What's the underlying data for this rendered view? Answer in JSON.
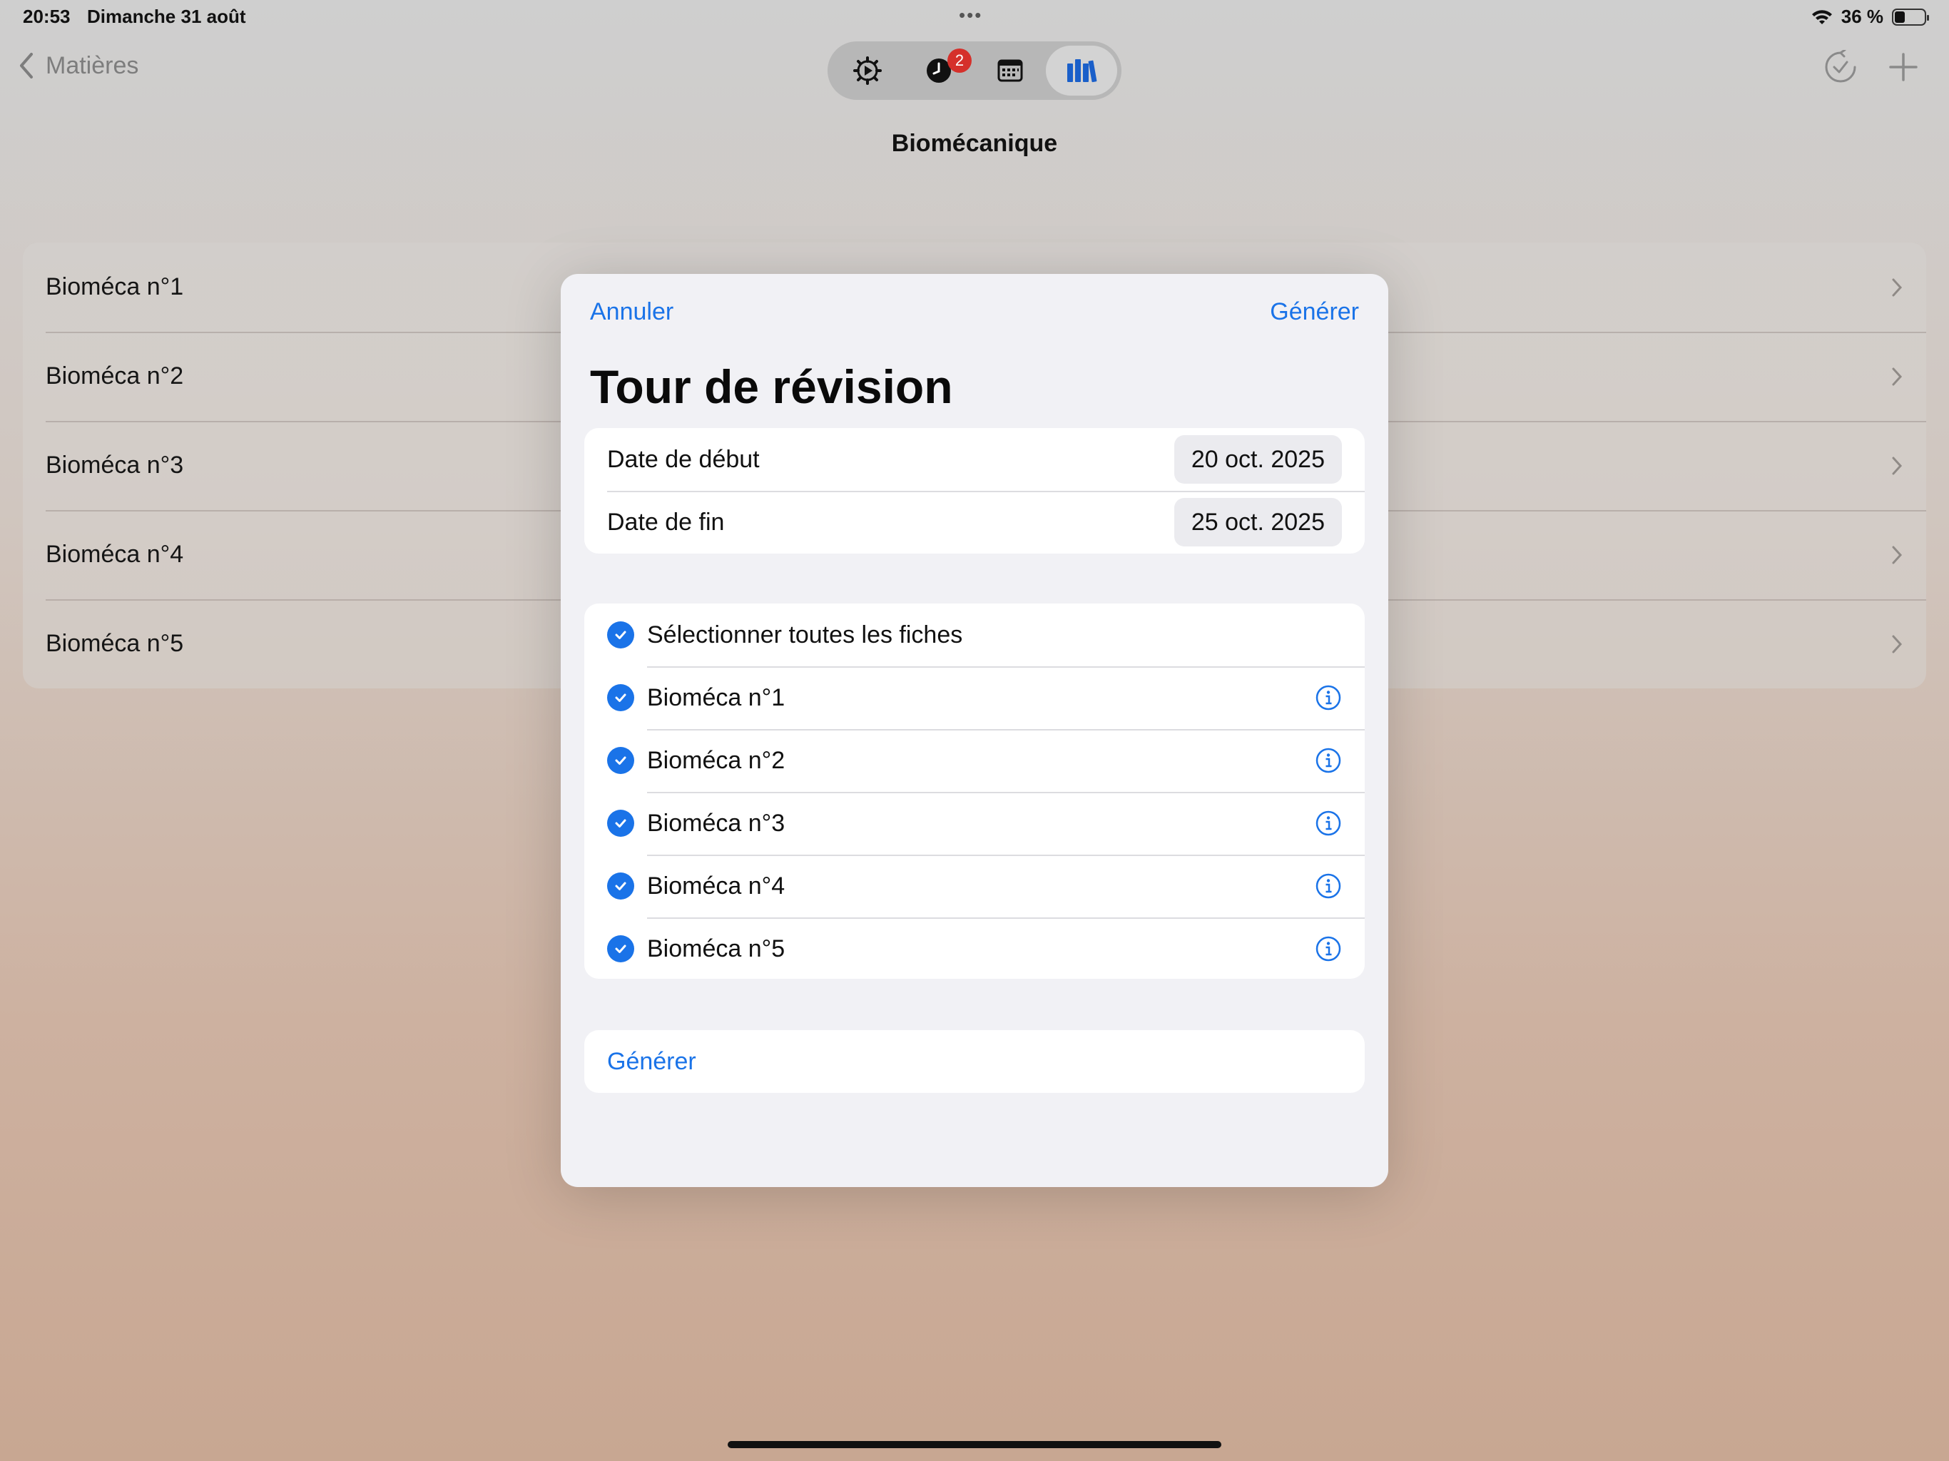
{
  "status_bar": {
    "time": "20:53",
    "date": "Dimanche 31 août",
    "dots": "•••",
    "battery_percent_label": "36 %",
    "battery_level": 0.36,
    "icons": [
      "wifi-icon",
      "battery-icon"
    ]
  },
  "nav": {
    "back_label": "Matières",
    "title": "Biomécanique",
    "segments": [
      {
        "icon": "settings-play-icon"
      },
      {
        "icon": "clock-icon",
        "badge": "2"
      },
      {
        "icon": "calendar-icon"
      },
      {
        "icon": "library-icon",
        "active": true
      }
    ],
    "actions": [
      "revision-check-icon",
      "plus-icon"
    ]
  },
  "background_list": {
    "items": [
      {
        "label": "Bioméca n°1"
      },
      {
        "label": "Bioméca n°2"
      },
      {
        "label": "Bioméca n°3"
      },
      {
        "label": "Bioméca n°4"
      },
      {
        "label": "Bioméca n°5"
      }
    ]
  },
  "modal": {
    "cancel_label": "Annuler",
    "generate_top_label": "Générer",
    "title": "Tour de révision",
    "dates": {
      "start_label": "Date de début",
      "start_value": "20 oct. 2025",
      "end_label": "Date de fin",
      "end_value": "25 oct. 2025"
    },
    "select_all_label": "Sélectionner toutes les fiches",
    "sheets": [
      {
        "label": "Bioméca n°1",
        "checked": true
      },
      {
        "label": "Bioméca n°2",
        "checked": true
      },
      {
        "label": "Bioméca n°3",
        "checked": true
      },
      {
        "label": "Bioméca n°4",
        "checked": true
      },
      {
        "label": "Bioméca n°5",
        "checked": true
      }
    ],
    "generate_bottom_label": "Générer"
  },
  "colors": {
    "accent": "#1a73e8",
    "badge": "#d5302b",
    "modal_background": "#f1f1f5",
    "card_background": "#ffffff"
  }
}
